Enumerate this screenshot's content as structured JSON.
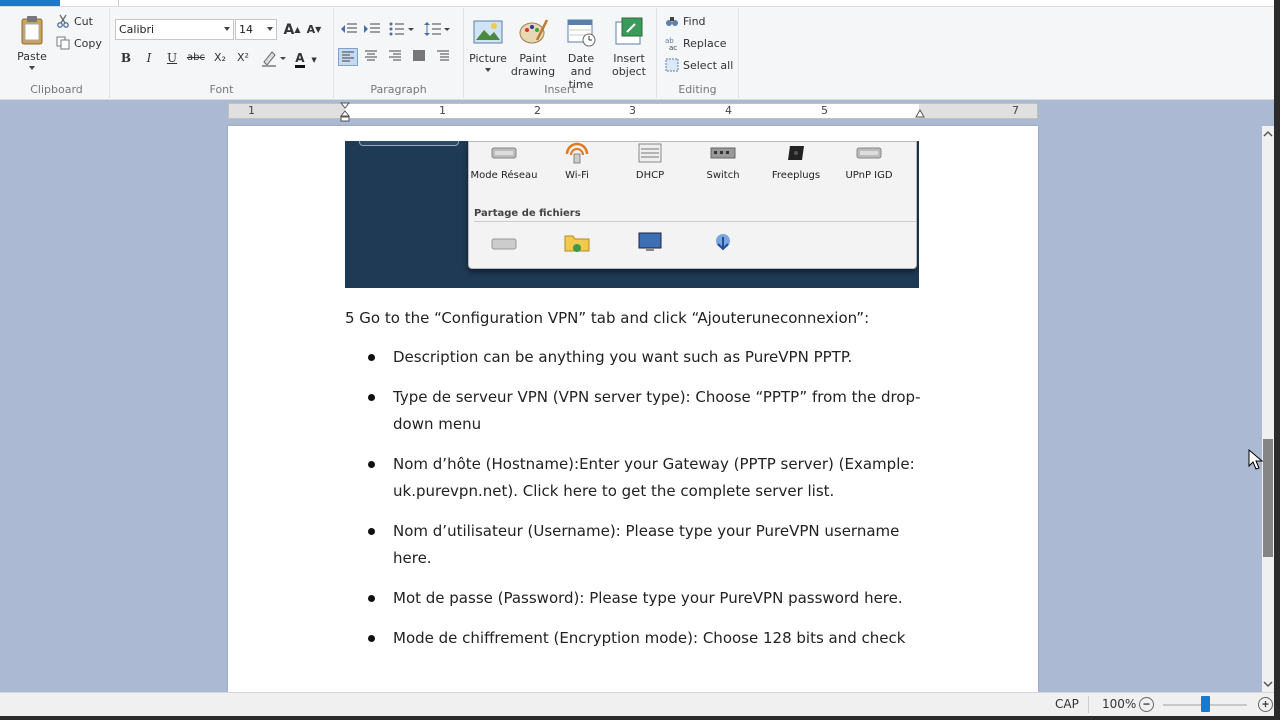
{
  "ribbon": {
    "clipboard": {
      "label": "Clipboard",
      "paste": "Paste",
      "cut": "Cut",
      "copy": "Copy"
    },
    "font": {
      "label": "Font",
      "family": "Calibri",
      "size": "14",
      "grow": "A",
      "shrink": "A",
      "bold": "B",
      "italic": "I",
      "underline": "U",
      "strike": "abc",
      "subscript": "X₂",
      "superscript": "X²",
      "color": "A"
    },
    "paragraph": {
      "label": "Paragraph"
    },
    "insert": {
      "label": "Insert",
      "picture": "Picture",
      "paint": "Paint drawing",
      "datetime": "Date and time",
      "object": "Insert object"
    },
    "editing": {
      "label": "Editing",
      "find": "Find",
      "replace": "Replace",
      "select_all": "Select all"
    }
  },
  "ruler": {
    "numbers": [
      "1",
      "1",
      "2",
      "3",
      "4",
      "5",
      "7"
    ]
  },
  "embedded_screenshot": {
    "icons": [
      {
        "label": "Mode Réseau"
      },
      {
        "label": "Wi-Fi"
      },
      {
        "label": "DHCP"
      },
      {
        "label": "Switch"
      },
      {
        "label": "Freeplugs"
      },
      {
        "label": "UPnP IGD"
      }
    ],
    "section": "Partage de fichiers"
  },
  "document": {
    "intro": "5 Go to the “Configuration VPN” tab and click “Ajouteruneconnexion”:",
    "bullets": [
      "Description can be anything you want such as PureVPN PPTP.",
      "Type de serveur VPN (VPN server type): Choose “PPTP” from the drop-down menu",
      "Nom d’hôte (Hostname):Enter your Gateway (PPTP server) (Example: uk.purevpn.net). Click here to get the complete server list.",
      "Nom d’utilisateur (Username): Please type your PureVPN username here.",
      "Mot de passe (Password): Please type your PureVPN password here.",
      "Mode de chiffrement (Encryption mode): Choose 128 bits and check"
    ]
  },
  "statusbar": {
    "caps": "CAP",
    "zoom": "100%",
    "zoom_fraction": 0.5
  },
  "colors": {
    "accent": "#1979ca",
    "workspace": "#abb9d3"
  }
}
